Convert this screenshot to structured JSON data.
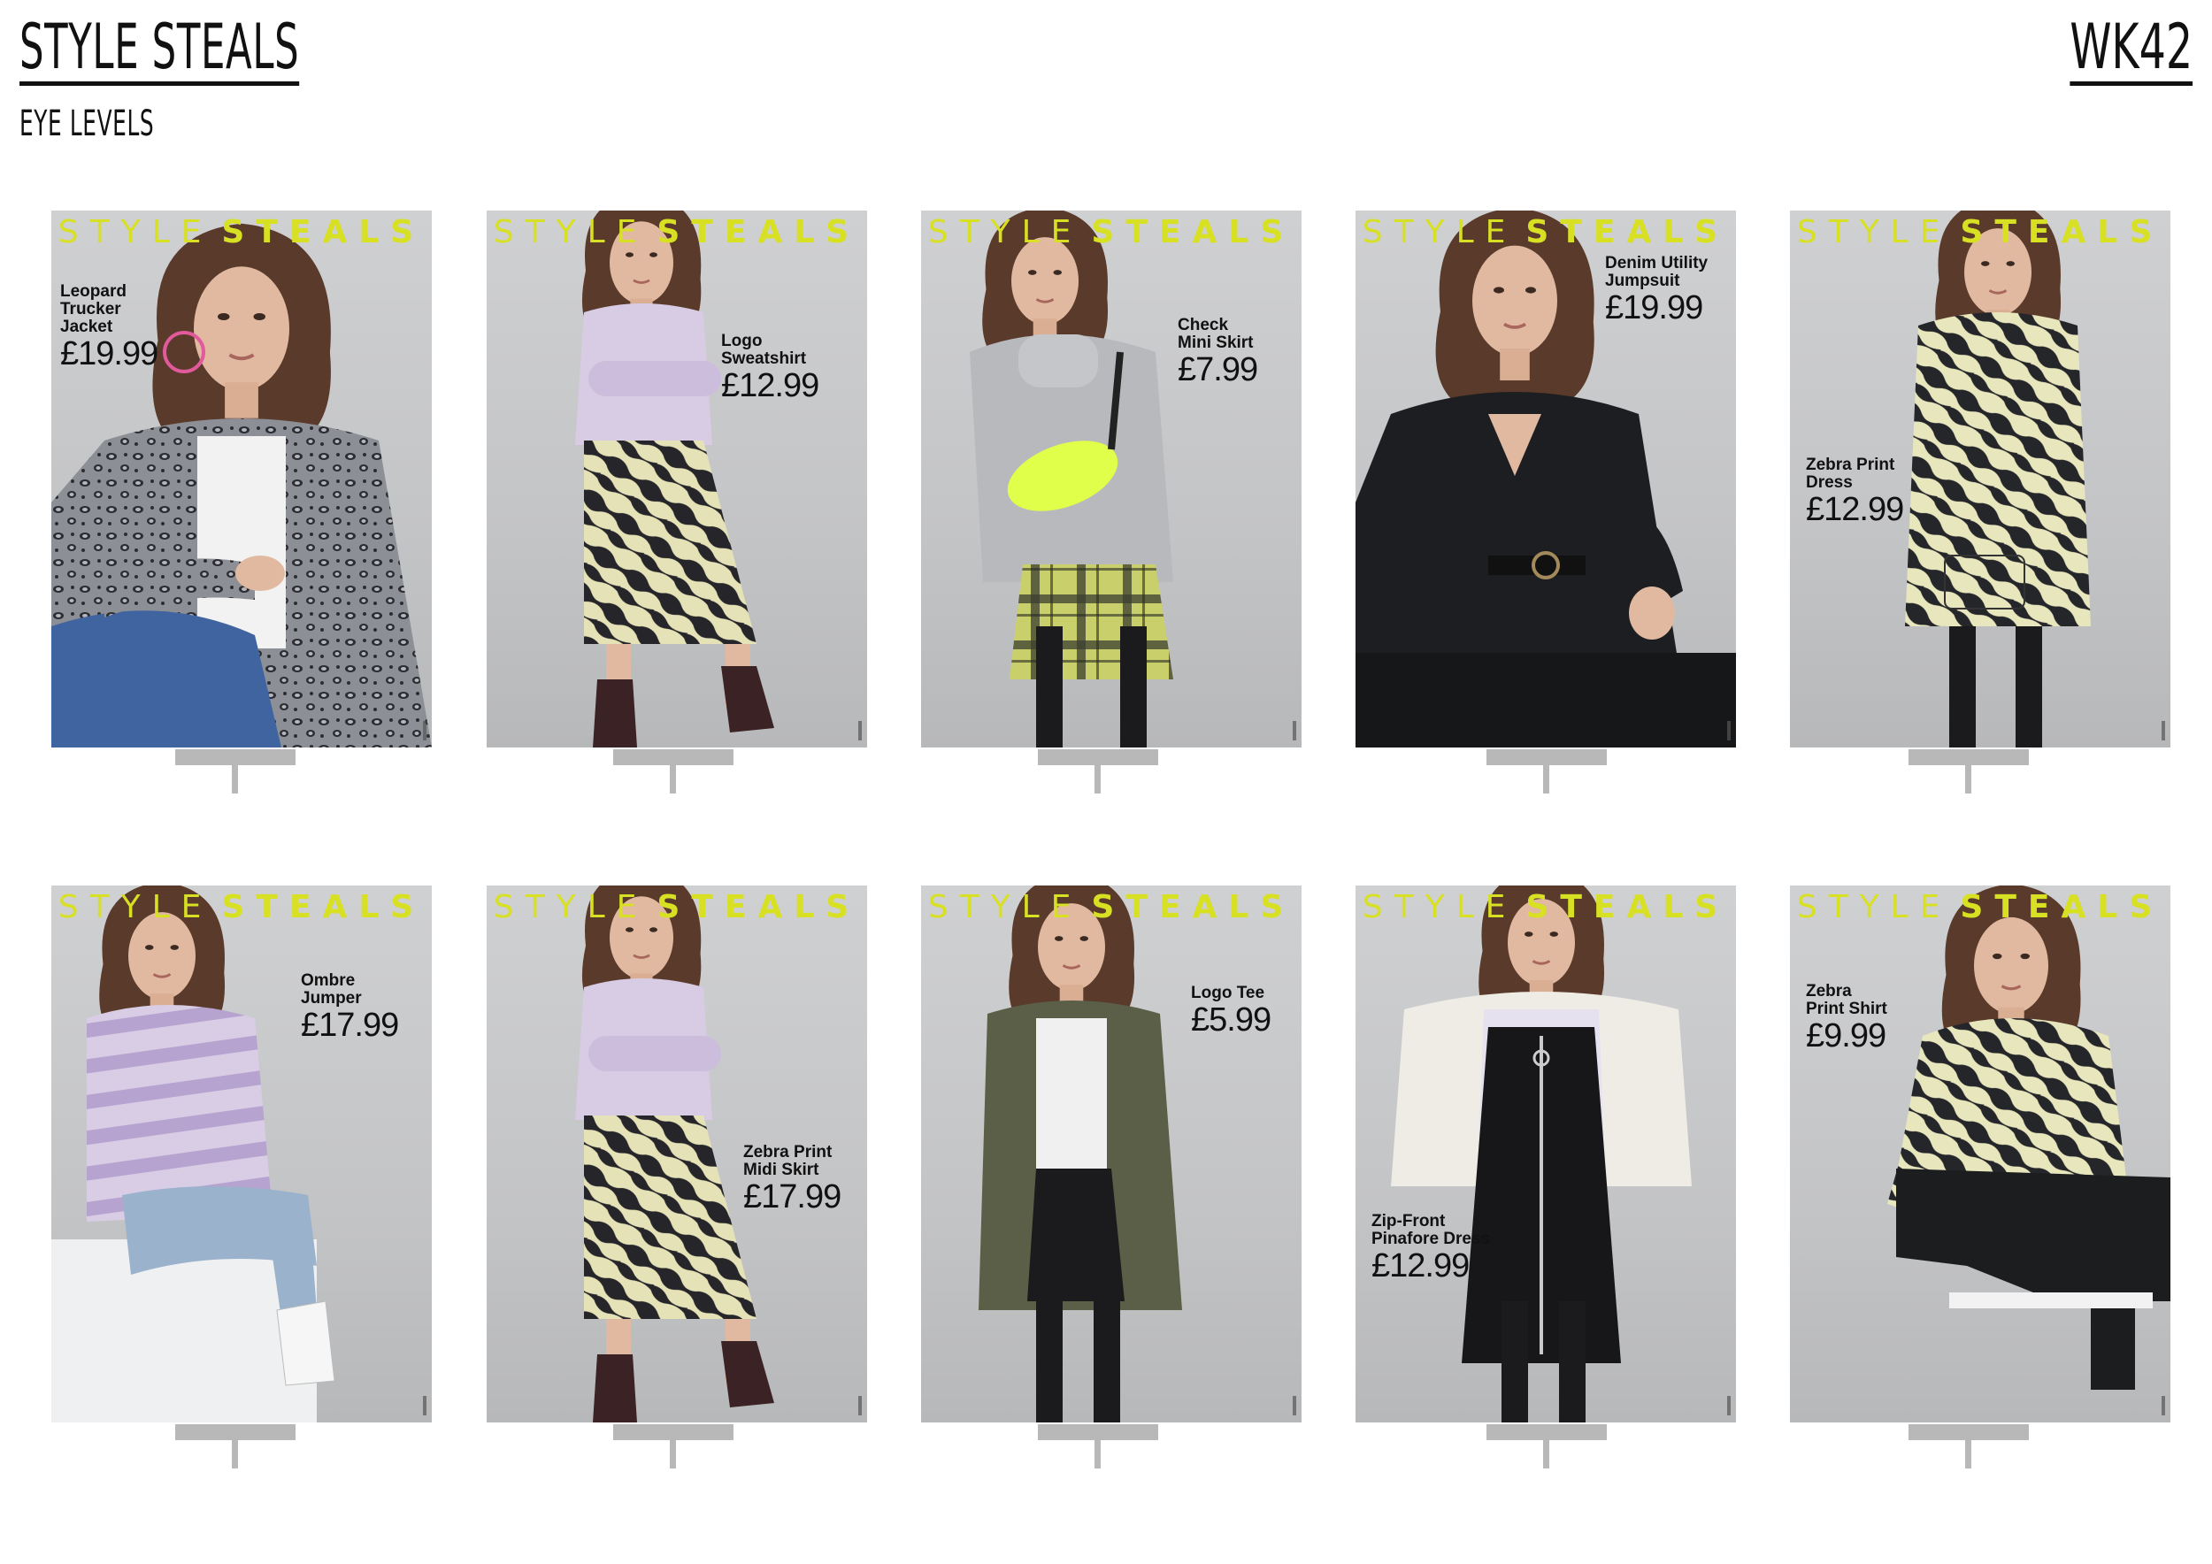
{
  "header": {
    "title": "STYLE STEALS",
    "subtitle": "EYE LEVELS",
    "week": "WK42"
  },
  "brand": {
    "word1": "STYLE",
    "word2": "STEALS",
    "color": "#d8e024"
  },
  "cards": [
    {
      "name": "Leopard\nTrucker\nJacket",
      "price": "£19.99",
      "outfit": "leopard-jacket"
    },
    {
      "name": "Logo\nSweatshirt",
      "price": "£12.99",
      "outfit": "lilac-sweat-zebra-skirt"
    },
    {
      "name": "Check\nMini Skirt",
      "price": "£7.99",
      "outfit": "check-skirt"
    },
    {
      "name": "Denim Utility\nJumpsuit",
      "price": "£19.99",
      "outfit": "black-jumpsuit"
    },
    {
      "name": "Zebra Print\nDress",
      "price": "£12.99",
      "outfit": "zebra-dress"
    },
    {
      "name": "Ombre\nJumper",
      "price": "£17.99",
      "outfit": "ombre-jumper"
    },
    {
      "name": "Zebra Print\nMidi Skirt",
      "price": "£17.99",
      "outfit": "lilac-sweat-zebra-skirt"
    },
    {
      "name": "Logo Tee",
      "price": "£5.99",
      "outfit": "khaki-jacket"
    },
    {
      "name": "Zip-Front\nPinafore Dress",
      "price": "£12.99",
      "outfit": "pinafore-dress"
    },
    {
      "name": "Zebra\nPrint Shirt",
      "price": "£9.99",
      "outfit": "zebra-shirt"
    }
  ]
}
